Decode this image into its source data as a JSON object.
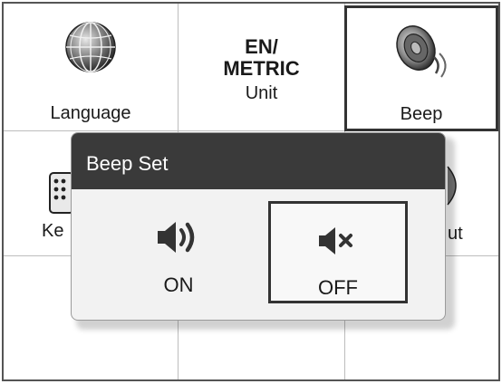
{
  "tiles": [
    {
      "name": "language",
      "label": "Language",
      "icon": "globe-icon"
    },
    {
      "name": "unit",
      "title": [
        "EN/",
        "METRIC"
      ],
      "label": "Unit"
    },
    {
      "name": "beep",
      "label": "Beep",
      "icon": "speaker-icon",
      "selected": true
    }
  ],
  "partial_tiles": [
    {
      "name": "keypad",
      "label": "Ke",
      "icon": "keypad-icon"
    },
    {
      "name": "about",
      "label": "ut"
    }
  ],
  "dialog": {
    "title": "Beep Set",
    "options": [
      {
        "name": "on",
        "label": "ON",
        "icon": "volume-on-icon",
        "selected": false
      },
      {
        "name": "off",
        "label": "OFF",
        "icon": "volume-mute-icon",
        "selected": true
      }
    ]
  }
}
